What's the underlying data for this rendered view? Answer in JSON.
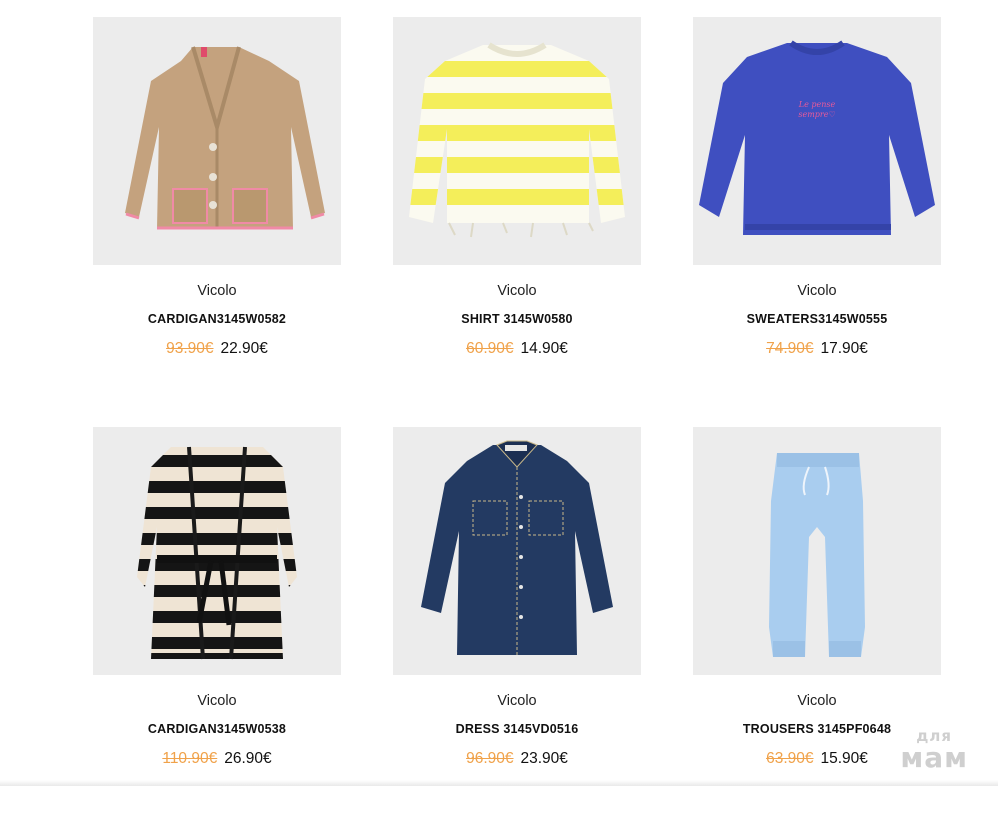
{
  "products": [
    {
      "brand": "Vicolo",
      "name": "CARDIGAN3145W0582",
      "old_price": "93.90€",
      "price": "22.90€",
      "icon": "beige-knit-cardigan"
    },
    {
      "brand": "Vicolo",
      "name": "SHIRT 3145W0580",
      "old_price": "60.90€",
      "price": "14.90€",
      "icon": "yellow-striped-sweater"
    },
    {
      "brand": "Vicolo",
      "name": "SWEATERS3145W0555",
      "old_price": "74.90€",
      "price": "17.90€",
      "icon": "blue-sweatshirt"
    },
    {
      "brand": "Vicolo",
      "name": "CARDIGAN3145W0538",
      "old_price": "110.90€",
      "price": "26.90€",
      "icon": "striped-long-cardigan"
    },
    {
      "brand": "Vicolo",
      "name": "DRESS 3145VD0516",
      "old_price": "96.90€",
      "price": "23.90€",
      "icon": "denim-shirt-dress"
    },
    {
      "brand": "Vicolo",
      "name": "TROUSERS 3145PF0648",
      "old_price": "63.90€",
      "price": "15.90€",
      "icon": "light-blue-joggers"
    }
  ],
  "watermark": {
    "line1": "для",
    "line2": "мам"
  },
  "colors": {
    "old_price": "#f0a24a",
    "image_bg": "#ececec"
  }
}
